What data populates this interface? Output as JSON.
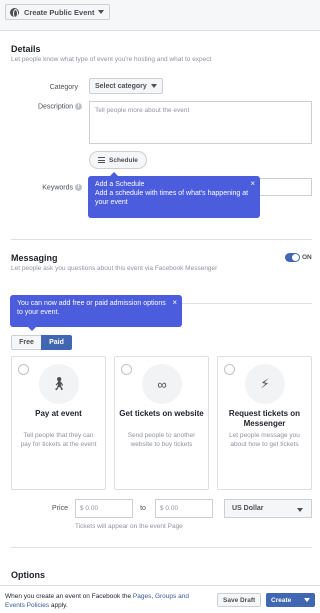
{
  "header": {
    "event_type": "Create Public Event"
  },
  "details": {
    "title": "Details",
    "subtitle": "Let people know what type of event you're hosting and what to expect",
    "category_label": "Category",
    "category_value": "Select category",
    "description_label": "Description",
    "description_placeholder": "Tell people more about the event",
    "schedule_button": "Schedule",
    "keywords_label": "Keywords"
  },
  "schedule_tooltip": {
    "title": "Add a Schedule",
    "body": "Add a schedule with times of what's happening at your event",
    "close": "×"
  },
  "messaging": {
    "title": "Messaging",
    "subtitle": "Let people ask you questions about this event via Facebook Messenger",
    "toggle_label": "ON",
    "toggle_on": true
  },
  "tickets_tooltip": {
    "body": "You can now add free or paid admission options to your event.",
    "close": "×"
  },
  "admission": {
    "free_label": "Free",
    "paid_label": "Paid",
    "selected": "Paid"
  },
  "options": [
    {
      "title": "Pay at event",
      "description": "Tell people that they can pay for tickets at the event",
      "icon": "person-walking-icon"
    },
    {
      "title": "Get tickets on website",
      "description": "Send people to another website to buy tickets",
      "icon": "link-icon"
    },
    {
      "title": "Request tickets on Messenger",
      "description": "Let people message you about how to get tickets",
      "icon": "messenger-icon"
    }
  ],
  "price": {
    "label": "Price",
    "from_placeholder": "$  0.00",
    "to_label": "to",
    "to_placeholder": "$  0.00",
    "currency": "US Dollar",
    "hint": "Tickets will appear on the event Page"
  },
  "options_section": {
    "title": "Options"
  },
  "footer": {
    "text_prefix": "When you create an event on Facebook the ",
    "link_text": "Pages, Groups and Events Policies",
    "text_suffix": " apply.",
    "save_draft": "Save Draft",
    "create": "Create"
  }
}
